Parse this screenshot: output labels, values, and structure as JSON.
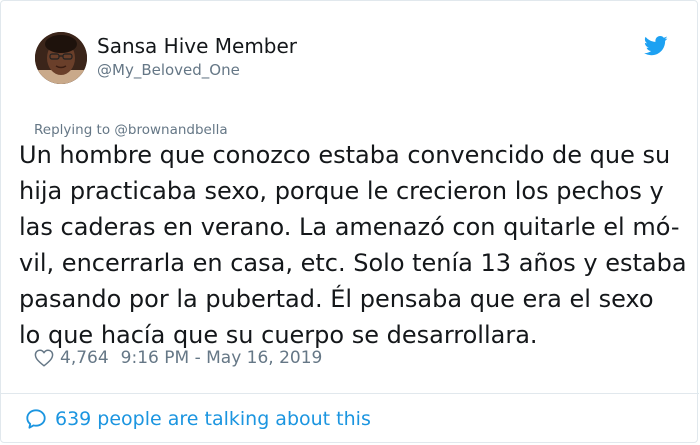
{
  "author": {
    "display_name": "Sansa Hive Member",
    "handle": "@My_Beloved_One"
  },
  "icons": {
    "brand": "twitter-bird-icon",
    "like": "heart-icon",
    "conversation": "speech-bubble-icon"
  },
  "reply_context": {
    "prefix": "Replying to ",
    "target": "@brownandbella"
  },
  "tweet": {
    "lines": [
      "Un hombre que conozco estaba convencido de que su",
      "hija practicaba sexo, porque le crecieron los pechos y",
      "las caderas en verano. La amenazó con quitarle el mó-",
      "vil, encerrarla en casa, etc. Solo tenía 13 años y estaba",
      "pasando por la pubertad. Él pensaba que era el sexo",
      "lo que hacía que su cuerpo se desarrollara."
    ]
  },
  "meta": {
    "likes": "4,764",
    "timestamp": "9:16 PM - May 16, 2019"
  },
  "footer": {
    "conversation": "639 people are talking about this"
  },
  "colors": {
    "link_blue": "#1b95e0",
    "muted_gray": "#657786",
    "text": "#14171a",
    "border": "#e1e8ed"
  }
}
